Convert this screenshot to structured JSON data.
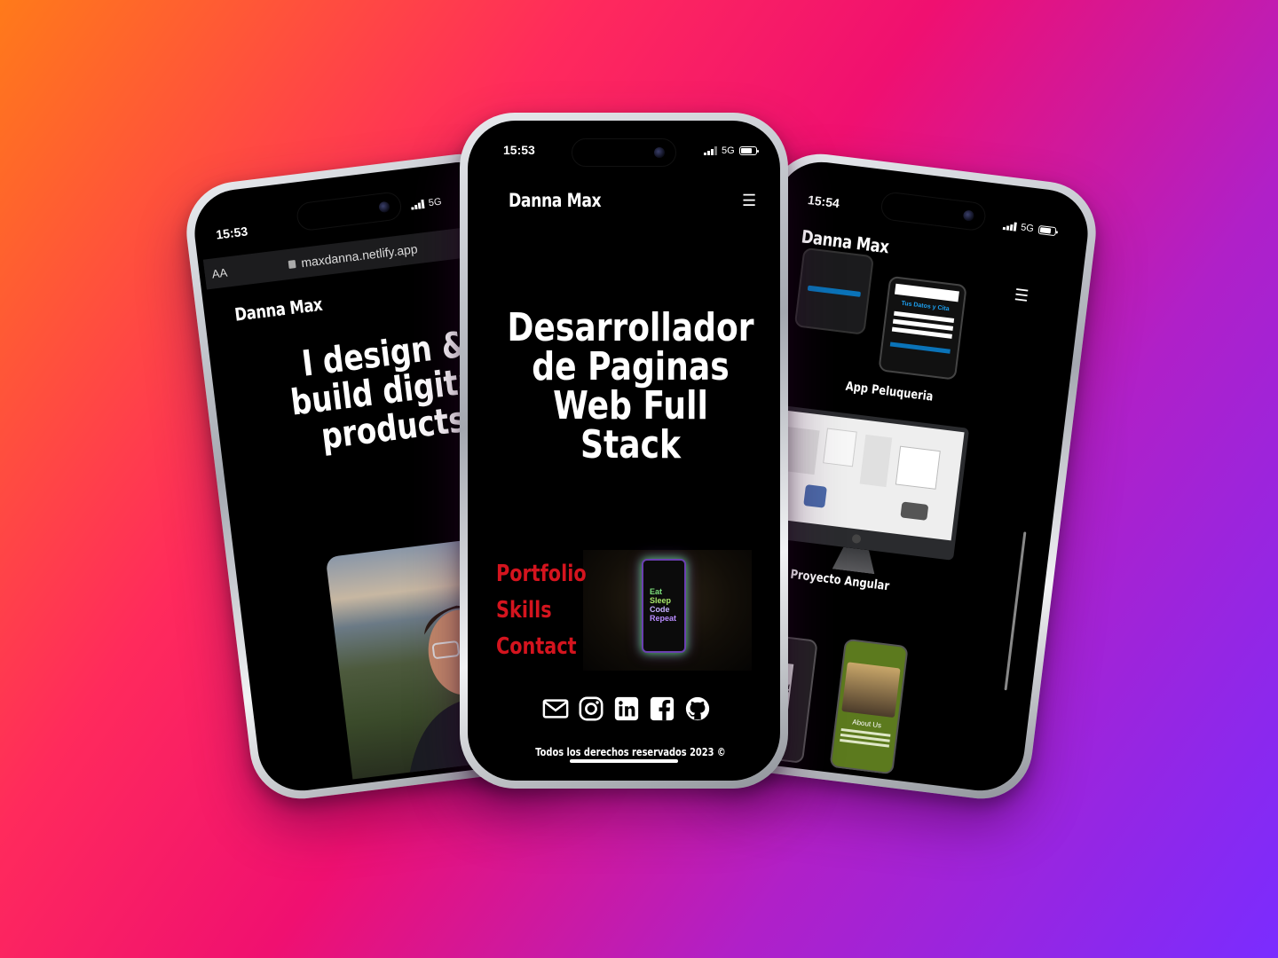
{
  "colors": {
    "bg_gradient": [
      "#ff7a1a",
      "#ff2a5c",
      "#f01070",
      "#b020c8",
      "#7a2cff"
    ],
    "nav_link": "#d4141e",
    "screen_bg": "#000000"
  },
  "left_phone": {
    "time": "15:53",
    "network": "5G",
    "text_size_control": "AA",
    "url": "maxdanna.netlify.app",
    "brand": "Danna Max",
    "hero_lines": [
      "I design &",
      "build digital",
      "products"
    ],
    "photo_icon": "portrait-photo-icon"
  },
  "center_phone": {
    "time": "15:53",
    "network": "5G",
    "brand": "Danna Max",
    "menu_icon": "hamburger-icon",
    "hero_lines": [
      "Desarrollador",
      "de Paginas",
      "Web Full",
      "Stack"
    ],
    "nav": [
      "Portfolio",
      "Skills",
      "Contact"
    ],
    "phone_art_text": [
      "Eat",
      "Sleep",
      "Code",
      "Repeat"
    ],
    "socials": [
      "mail-icon",
      "instagram-icon",
      "linkedin-icon",
      "facebook-icon",
      "github-icon"
    ],
    "footer": "Todos los derechos reservados 2023 ©"
  },
  "right_phone": {
    "time": "15:54",
    "network": "5G",
    "brand": "Danna Max",
    "menu_icon": "hamburger-icon",
    "projects": [
      {
        "caption": "App Peluqueria",
        "thumb_title": "Tus Datos y Cita"
      },
      {
        "caption": "Proyecto Angular"
      },
      {
        "caption": "",
        "thumb_title": "About Us"
      }
    ]
  }
}
